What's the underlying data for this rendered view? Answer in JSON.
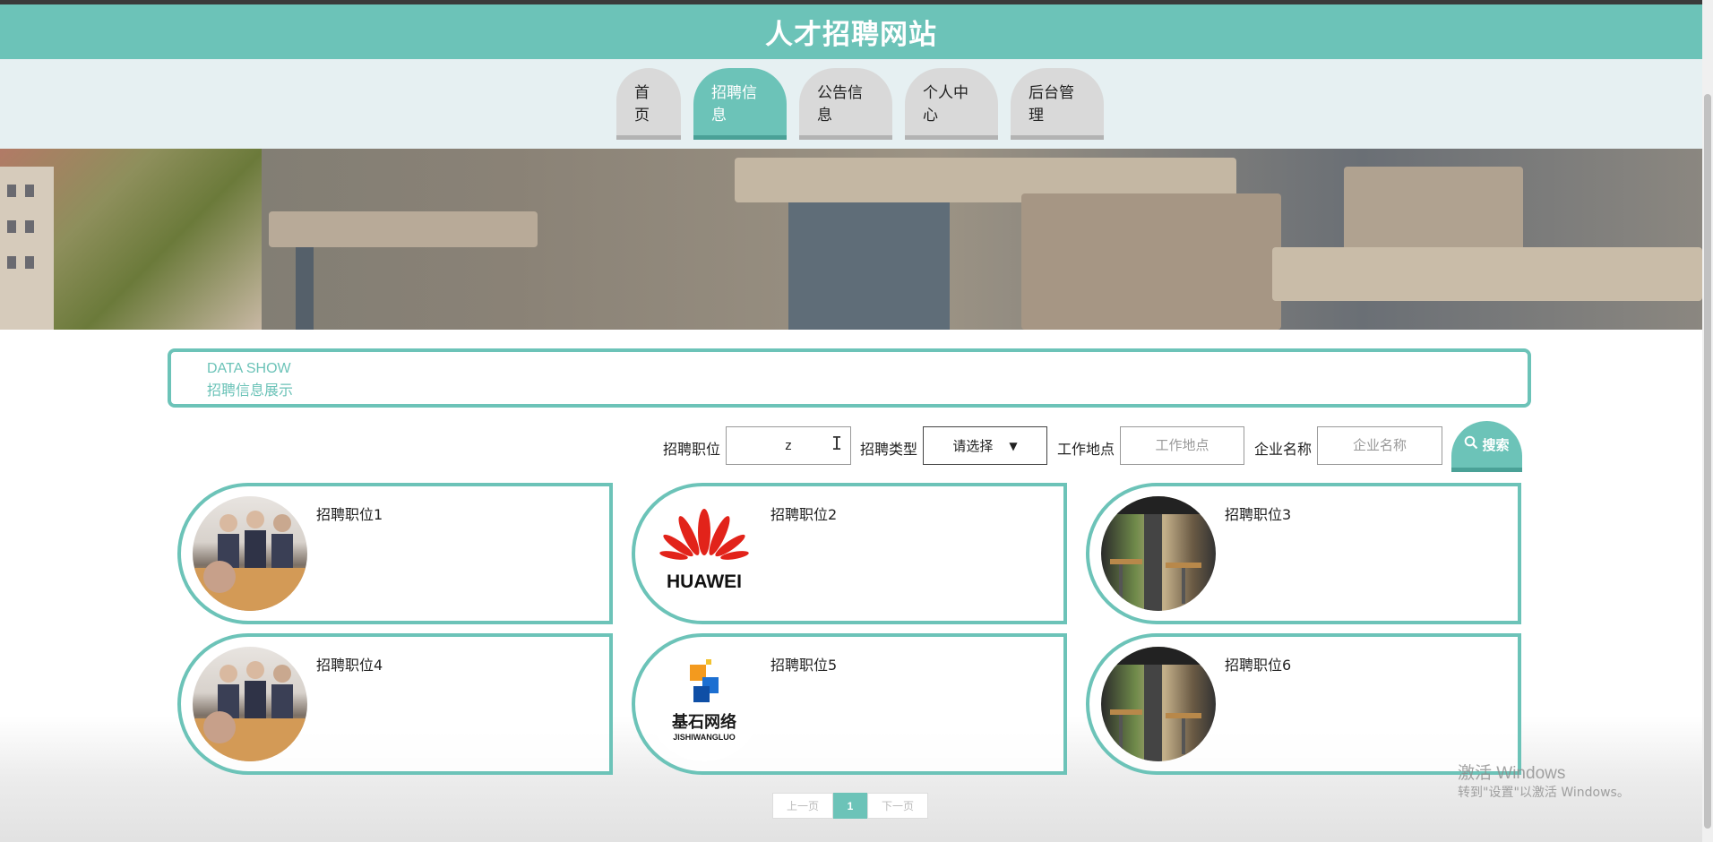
{
  "header": {
    "site_title": "人才招聘网站"
  },
  "nav": [
    {
      "label": "首页",
      "active": false
    },
    {
      "label": "招聘信息",
      "active": true
    },
    {
      "label": "公告信息",
      "active": false
    },
    {
      "label": "个人中心",
      "active": false
    },
    {
      "label": "后台管理",
      "active": false
    }
  ],
  "section": {
    "title_en": "DATA SHOW",
    "title_cn": "招聘信息展示"
  },
  "search": {
    "position_label": "招聘职位",
    "position_value": "z",
    "type_label": "招聘类型",
    "type_selected": "请选择",
    "location_label": "工作地点",
    "location_placeholder": "工作地点",
    "company_label": "企业名称",
    "company_placeholder": "企业名称",
    "button_label": "搜索"
  },
  "cards": [
    {
      "title": "招聘职位1",
      "image": "people-meeting"
    },
    {
      "title": "招聘职位2",
      "image": "huawei-logo"
    },
    {
      "title": "招聘职位3",
      "image": "cafe-interior"
    },
    {
      "title": "招聘职位4",
      "image": "people-meeting"
    },
    {
      "title": "招聘职位5",
      "image": "jishiwangluo-logo"
    },
    {
      "title": "招聘职位6",
      "image": "cafe-interior"
    }
  ],
  "logos": {
    "huawei": "HUAWEI",
    "jishi_cn": "基石网络",
    "jishi_en": "JISHIWANGLUO"
  },
  "pager": {
    "prev": "上一页",
    "current": "1",
    "next": "下一页"
  },
  "watermark": {
    "line1": "激活 Windows",
    "line2": "转到\"设置\"以激活 Windows。"
  },
  "colors": {
    "accent": "#6cc3b8",
    "accent_dark": "#4aa197",
    "nav_inactive": "#d9d9d9"
  }
}
